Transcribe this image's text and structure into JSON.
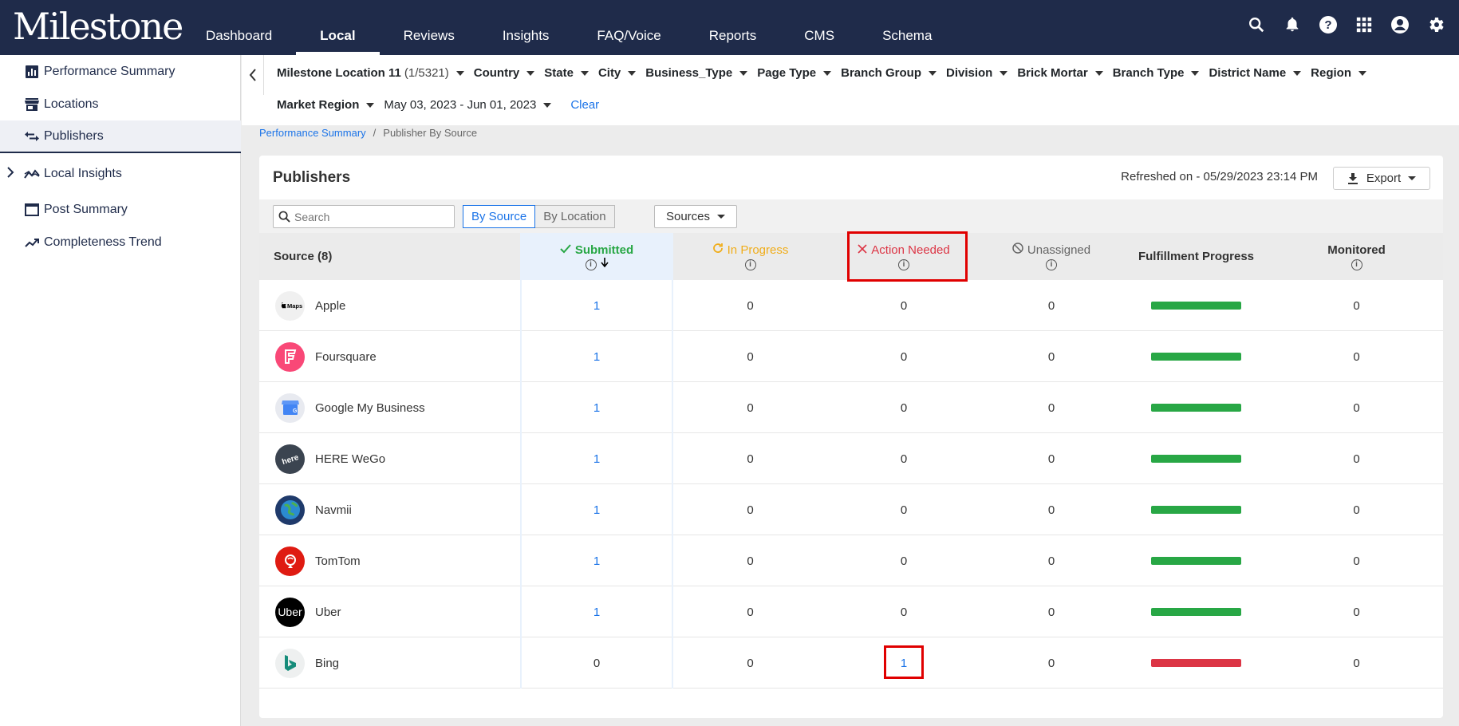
{
  "app": {
    "logo_text": "Milestone"
  },
  "nav": {
    "items": [
      {
        "label": "Dashboard"
      },
      {
        "label": "Local"
      },
      {
        "label": "Reviews"
      },
      {
        "label": "Insights"
      },
      {
        "label": "FAQ/Voice"
      },
      {
        "label": "Reports"
      },
      {
        "label": "CMS"
      },
      {
        "label": "Schema"
      }
    ],
    "active": "Local"
  },
  "sidebar": {
    "items": [
      {
        "label": "Performance Summary",
        "icon": "bar-chart-icon"
      },
      {
        "label": "Locations",
        "icon": "store-icon"
      },
      {
        "label": "Publishers",
        "icon": "swap-arrows-icon",
        "active": true
      },
      {
        "label": "Local Insights",
        "icon": "insights-icon",
        "expandable": true
      },
      {
        "label": "Post Summary",
        "icon": "window-icon"
      },
      {
        "label": "Completeness Trend",
        "icon": "trend-icon"
      }
    ]
  },
  "filters": {
    "location": "Milestone Location 11",
    "location_count": "(1/5321)",
    "items": [
      "Country",
      "State",
      "City",
      "Business_Type",
      "Page Type",
      "Branch Group",
      "Division",
      "Brick Mortar",
      "Branch Type",
      "District Name",
      "Region"
    ],
    "market_region": "Market Region",
    "date_range": "May 03, 2023 - Jun 01, 2023",
    "clear": "Clear"
  },
  "breadcrumb": {
    "parent": "Performance Summary",
    "separator": "/",
    "current": "Publisher By Source"
  },
  "card": {
    "title": "Publishers",
    "refreshed": "Refreshed on - 05/29/2023 23:14 PM",
    "export": "Export",
    "search_placeholder": "Search",
    "view_by_source": "By Source",
    "view_by_location": "By Location",
    "sources": "Sources"
  },
  "table": {
    "headers": {
      "source": "Source (8)",
      "submitted": "Submitted",
      "in_progress": "In Progress",
      "action_needed": "Action Needed",
      "unassigned": "Unassigned",
      "fulfillment": "Fulfillment Progress",
      "monitored": "Monitored"
    },
    "rows": [
      {
        "source": "Apple",
        "logo": "apple-maps-icon",
        "logo_text": "Maps",
        "submitted": "1",
        "in_progress": "0",
        "action_needed": "0",
        "unassigned": "0",
        "fulfillment": 1.0,
        "status": "good",
        "monitored": "0"
      },
      {
        "source": "Foursquare",
        "logo": "foursquare-icon",
        "logo_text": "F",
        "submitted": "1",
        "in_progress": "0",
        "action_needed": "0",
        "unassigned": "0",
        "fulfillment": 1.0,
        "status": "good",
        "monitored": "0"
      },
      {
        "source": "Google My Business",
        "logo": "google-my-business-icon",
        "logo_text": "G",
        "submitted": "1",
        "in_progress": "0",
        "action_needed": "0",
        "unassigned": "0",
        "fulfillment": 1.0,
        "status": "good",
        "monitored": "0"
      },
      {
        "source": "HERE WeGo",
        "logo": "here-icon",
        "logo_text": "here",
        "submitted": "1",
        "in_progress": "0",
        "action_needed": "0",
        "unassigned": "0",
        "fulfillment": 1.0,
        "status": "good",
        "monitored": "0"
      },
      {
        "source": "Navmii",
        "logo": "navmii-icon",
        "logo_text": "",
        "submitted": "1",
        "in_progress": "0",
        "action_needed": "0",
        "unassigned": "0",
        "fulfillment": 1.0,
        "status": "good",
        "monitored": "0"
      },
      {
        "source": "TomTom",
        "logo": "tomtom-icon",
        "logo_text": "",
        "submitted": "1",
        "in_progress": "0",
        "action_needed": "0",
        "unassigned": "0",
        "fulfillment": 1.0,
        "status": "good",
        "monitored": "0"
      },
      {
        "source": "Uber",
        "logo": "uber-icon",
        "logo_text": "Uber",
        "submitted": "1",
        "in_progress": "0",
        "action_needed": "0",
        "unassigned": "0",
        "fulfillment": 1.0,
        "status": "good",
        "monitored": "0"
      },
      {
        "source": "Bing",
        "logo": "bing-icon",
        "logo_text": "b",
        "submitted": "0",
        "in_progress": "0",
        "action_needed": "1",
        "unassigned": "0",
        "fulfillment": 1.0,
        "status": "bad",
        "monitored": "0"
      }
    ]
  },
  "colors": {
    "header_bg": "#1f2b4a",
    "submitted": "#28a745",
    "in_progress": "#f0ad1a",
    "action_needed": "#dc3545",
    "link": "#1a73e8",
    "highlight": "#e00000"
  }
}
